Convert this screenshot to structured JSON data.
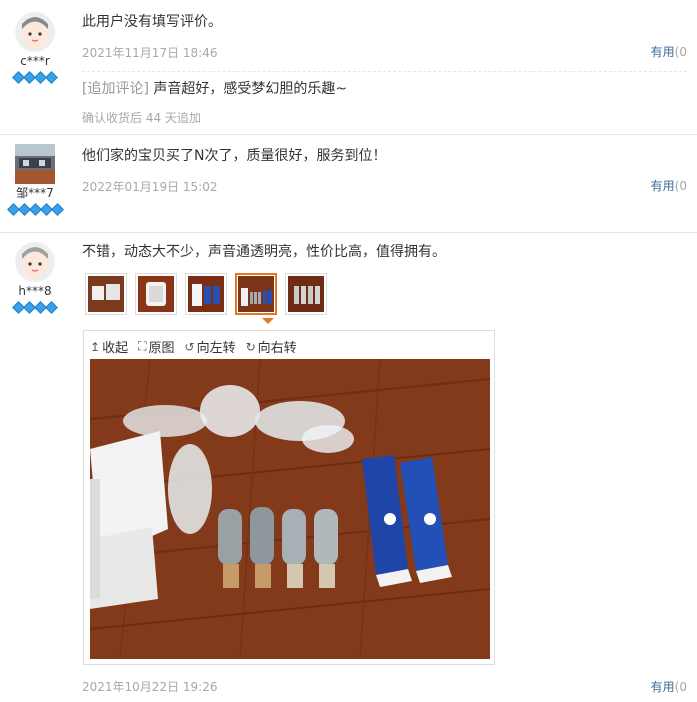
{
  "reviews": [
    {
      "user": "c***r",
      "text": "此用户没有填写评价。",
      "date": "2021年11月17日 18:46",
      "useful": "有用",
      "useful_paren": "(0",
      "append_tag": "[追加评论]",
      "append_text": "声音超好，感受梦幻胆的乐趣~",
      "append_meta": "确认收货后 44 天追加"
    },
    {
      "user": "邹***7",
      "text": "他们家的宝贝买了N次了，质量很好，服务到位！",
      "date": "2022年01月19日 15:02",
      "useful": "有用",
      "useful_paren": "(0"
    },
    {
      "user": "h***8",
      "text": "不错，动态大不少，声音通透明亮，性价比高，值得拥有。",
      "date": "2021年10月22日 19:26",
      "useful": "有用",
      "useful_paren": "(0"
    }
  ],
  "viewer": {
    "collapse": "收起",
    "original": "原图",
    "rotate_left": "向左转",
    "rotate_right": "向右转"
  }
}
